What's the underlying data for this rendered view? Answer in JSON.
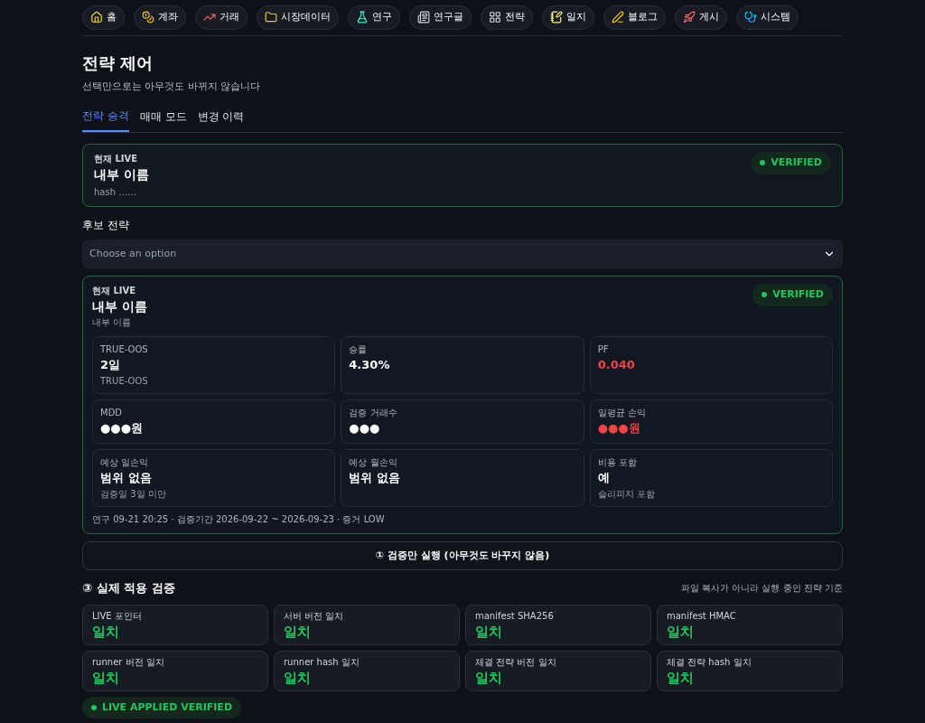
{
  "nav": [
    {
      "label": "홈"
    },
    {
      "label": "계좌"
    },
    {
      "label": "거래"
    },
    {
      "label": "시장데이터"
    },
    {
      "label": "연구"
    },
    {
      "label": "연구글"
    },
    {
      "label": "전략"
    },
    {
      "label": "일지"
    },
    {
      "label": "블로그"
    },
    {
      "label": "게시"
    },
    {
      "label": "시스템"
    }
  ],
  "page": {
    "title": "전략 제어",
    "subtitle": "선택만으로는 아무것도 바뀌지 않습니다"
  },
  "tabs": [
    {
      "label": "전략 승격",
      "selected": true
    },
    {
      "label": "매매 모드",
      "selected": false
    },
    {
      "label": "변경 이력",
      "selected": false
    }
  ],
  "current_card": {
    "eyebrow": "현재 LIVE",
    "name": "내부 이름",
    "detail": "hash ……",
    "badge": "VERIFIED"
  },
  "candidate": {
    "label": "후보 전략",
    "placeholder": "Choose an option"
  },
  "candidate_card": {
    "eyebrow": "현재 LIVE",
    "name": "내부 이름",
    "detail": "내부 이름",
    "badge": "VERIFIED",
    "metrics": [
      {
        "label": "TRUE-OOS",
        "value": "2일",
        "note": "TRUE-OOS",
        "alert": false
      },
      {
        "label": "승률",
        "value": "4.30%",
        "alert": false
      },
      {
        "label": "PF",
        "value": "0.040",
        "alert": true
      },
      {
        "label": "MDD",
        "value": "●●●원",
        "alert": false
      },
      {
        "label": "검증 거래수",
        "value": "●●●",
        "alert": false
      },
      {
        "label": "일평균 손익",
        "value": "●●●원",
        "alert": true
      },
      {
        "label": "예상 일손익",
        "value": "범위 없음",
        "note": "검증일 3일 미만",
        "alert": false
      },
      {
        "label": "예상 월손익",
        "value": "범위 없음",
        "alert": false
      },
      {
        "label": "비용 포함",
        "value": "예",
        "note": "슬리피지 포함",
        "alert": false
      }
    ],
    "footer": "연구 09-21 20:25 · 검증기간 2026-09-22 ~ 2026-09-23 · 증거 LOW"
  },
  "verify_button": "① 검증만 실행 (아무것도 바꾸지 않음)",
  "applied": {
    "title": "③ 실제 적용 검증",
    "note": "파일 복사가 아니라 실행 중인 전략 기준",
    "checks": [
      {
        "label": "LIVE 포인터",
        "value": "일치"
      },
      {
        "label": "서버 버전 일치",
        "value": "일치"
      },
      {
        "label": "manifest SHA256",
        "value": "일치"
      },
      {
        "label": "manifest HMAC",
        "value": "일치"
      },
      {
        "label": "runner 버전 일치",
        "value": "일치"
      },
      {
        "label": "runner hash 일치",
        "value": "일치"
      },
      {
        "label": "체결 전략 버전 일치",
        "value": "일치"
      },
      {
        "label": "체결 전략 hash 일치",
        "value": "일치"
      }
    ],
    "badge": "LIVE APPLIED VERIFIED"
  }
}
